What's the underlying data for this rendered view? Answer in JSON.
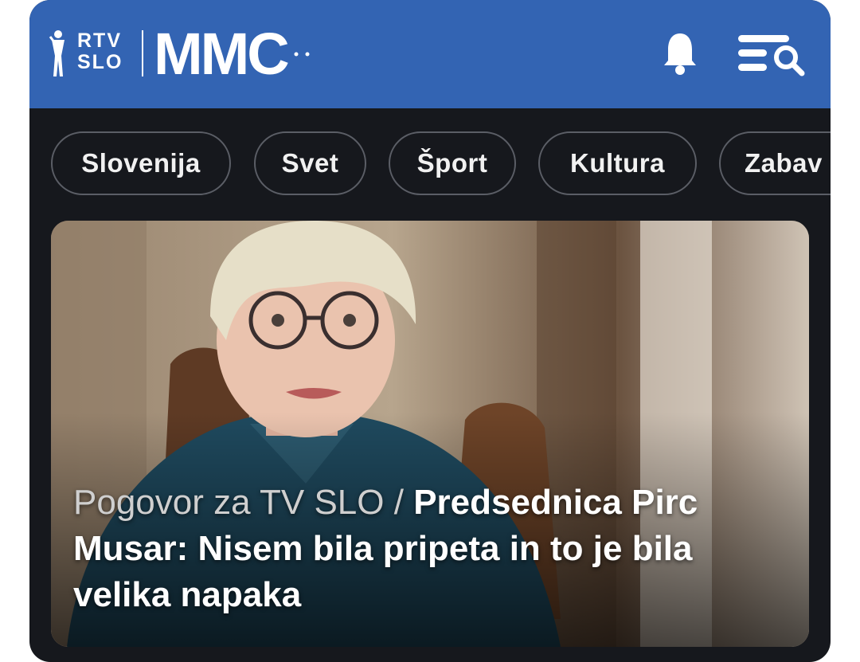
{
  "header": {
    "logo_rtv_line1": "RTV",
    "logo_rtv_line2": "SLO",
    "logo_mmc": "MMC",
    "bell_icon": "bell-icon",
    "menu_search_icon": "menu-search-icon",
    "brand_color": "#3364b3"
  },
  "categories": [
    {
      "label": "Slovenija"
    },
    {
      "label": "Svet"
    },
    {
      "label": "Šport"
    },
    {
      "label": "Kultura"
    },
    {
      "label": "Zabav"
    }
  ],
  "hero": {
    "kicker": "Pogovor za TV SLO /",
    "title": "Predsednica Pirc Musar: Nisem bila pripeta in to je bila velika napaka"
  }
}
